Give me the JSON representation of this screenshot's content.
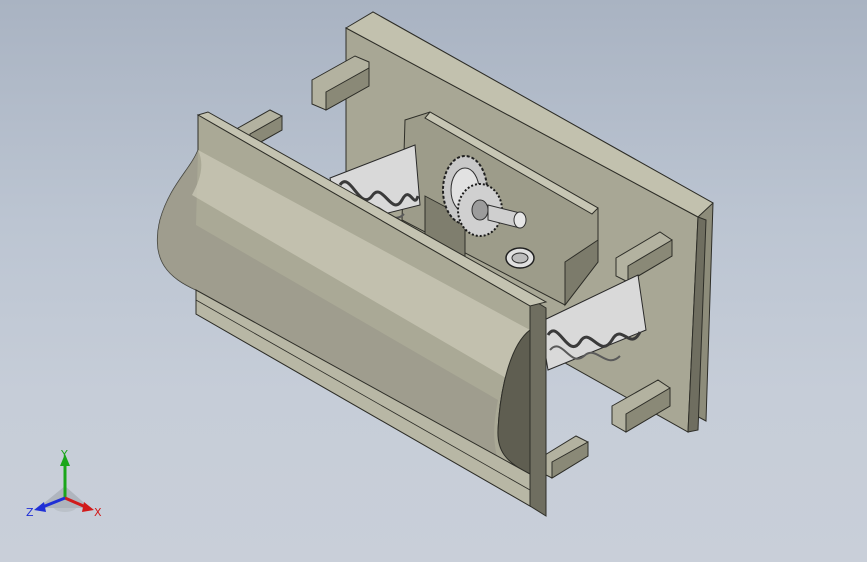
{
  "viewport": {
    "background_top": "#a9b3c2",
    "background_bottom": "#c9cfd9"
  },
  "model": {
    "description_icon": "gearbox-assembly-3d-model",
    "colors": {
      "housing_light": "#aaa996",
      "housing_mid": "#8d8c7a",
      "housing_dark": "#6f6e60",
      "edge": "#2e2e28",
      "metal": "#d8d8d8"
    }
  },
  "triad": {
    "x_label": "X",
    "y_label": "Y",
    "z_label": "Z",
    "x_color": "#d11a1a",
    "y_color": "#1aa61a",
    "z_color": "#1f2fd6"
  }
}
